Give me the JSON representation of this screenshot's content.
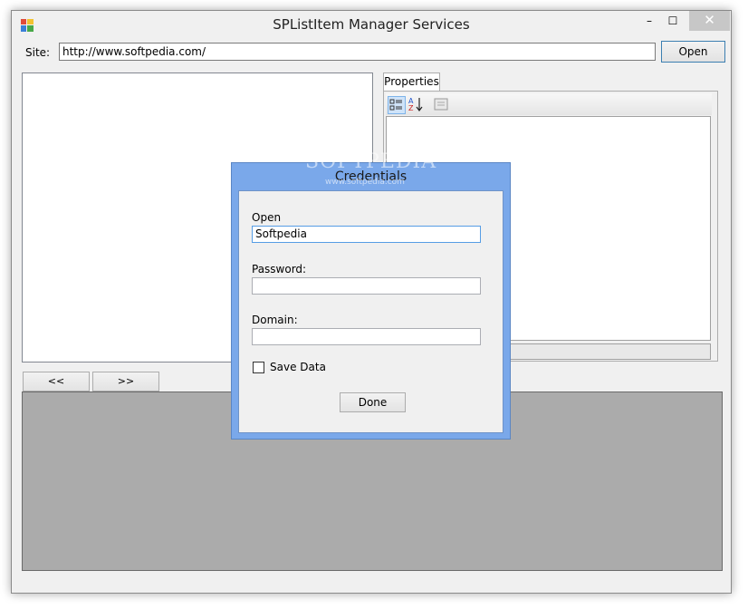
{
  "window": {
    "title": "SPListItem Manager Services",
    "min_glyph": "–",
    "max_glyph": "☐",
    "close_glyph": "✕"
  },
  "site": {
    "label": "Site:",
    "value": "http://www.softpedia.com/",
    "open_label": "Open"
  },
  "properties": {
    "tab_label": "Properties"
  },
  "nav": {
    "prev_label": "<<",
    "next_label": ">>"
  },
  "dialog": {
    "title": "Credentials",
    "user_label": "Open",
    "user_value": "Softpedia",
    "password_label": "Password:",
    "password_value": "",
    "domain_label": "Domain:",
    "domain_value": "",
    "save_label": "Save Data",
    "save_checked": false,
    "done_label": "Done"
  },
  "watermark": {
    "text": "SOFTPEDIA",
    "sub": "www.softpedia.com"
  },
  "colors": {
    "dialog_frame": "#7aa8ea",
    "gray_panel": "#ababab",
    "accent": "#3c7fb1"
  }
}
